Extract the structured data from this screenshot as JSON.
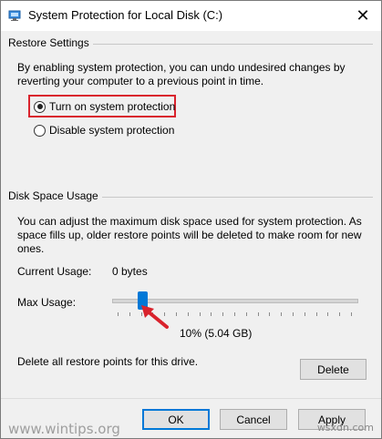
{
  "window": {
    "title": "System Protection for Local Disk (C:)",
    "close_glyph": "✕"
  },
  "restore_settings": {
    "group_label": "Restore Settings",
    "description_line1": "By enabling system protection, you can undo undesired changes by",
    "description_line2": "reverting your computer to a previous point in time.",
    "options": [
      {
        "label": "Turn on system protection",
        "selected": true
      },
      {
        "label": "Disable system protection",
        "selected": false
      }
    ]
  },
  "disk_space": {
    "group_label": "Disk Space Usage",
    "description_line1": "You can adjust the maximum disk space used for system protection. As",
    "description_line2": "space fills up, older restore points will be deleted to make room for new",
    "description_line3": "ones.",
    "current_usage_label": "Current Usage:",
    "current_usage_value": "0 bytes",
    "max_usage_label": "Max Usage:",
    "max_usage_percent": 10,
    "max_usage_readout": "10% (5.04 GB)",
    "delete_description": "Delete all restore points for this drive.",
    "delete_label": "Delete"
  },
  "footer": {
    "ok_label": "OK",
    "cancel_label": "Cancel",
    "apply_label": "Apply"
  },
  "watermarks": {
    "left": "www.wintips.org",
    "right": "wsxdn.com"
  },
  "colors": {
    "accent": "#0078d7",
    "highlight": "#d9232d"
  }
}
